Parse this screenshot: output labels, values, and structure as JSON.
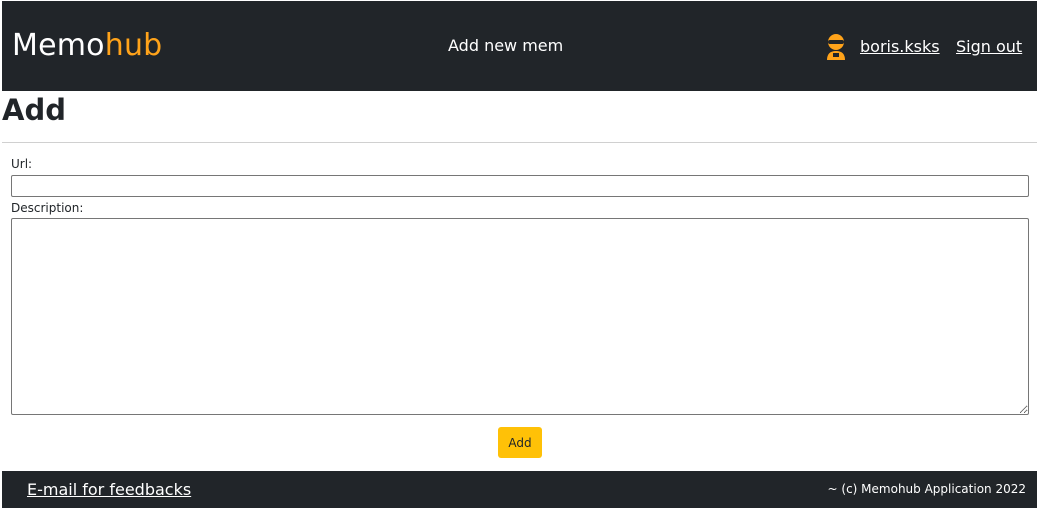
{
  "header": {
    "logo_part1": "Memo",
    "logo_part2": "hub",
    "nav_link": "Add new mem",
    "username": "boris.ksks",
    "signout": "Sign out",
    "user_icon": "user-avatar-icon",
    "accent_color": "#ffa31a",
    "bg_color": "#212529"
  },
  "main": {
    "title": "Add",
    "url_label": "Url:",
    "url_value": "",
    "description_label": "Description:",
    "description_value": "",
    "submit_label": "Add",
    "button_color": "#ffc107"
  },
  "footer": {
    "feedback_link": "E-mail for feedbacks",
    "copyright": "~ (c) Memohub Application 2022"
  }
}
